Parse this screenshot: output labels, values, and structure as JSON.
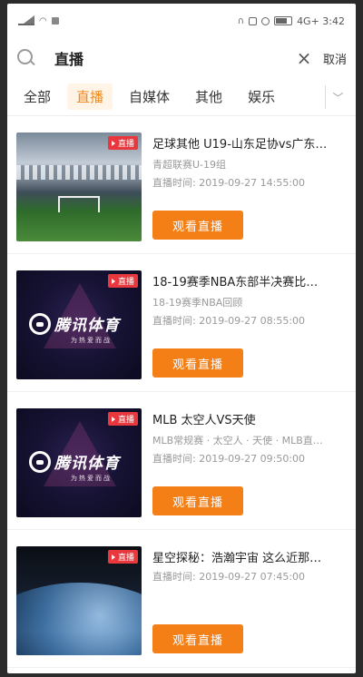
{
  "status_bar": {
    "right_text": "4G+ 3:42"
  },
  "search": {
    "query": "直播",
    "cancel_label": "取消"
  },
  "tabs": [
    {
      "label": "全部",
      "active": false
    },
    {
      "label": "直播",
      "active": true
    },
    {
      "label": "自媒体",
      "active": false
    },
    {
      "label": "其他",
      "active": false
    },
    {
      "label": "娱乐",
      "active": false
    }
  ],
  "items": [
    {
      "thumb": "stadium",
      "badge": "直播",
      "title": "足球其他 U19-山东足协vs广东…",
      "sub": "青超联赛U-19组",
      "time": "直播时间: 2019-09-27 14:55:00",
      "button": "观看直播"
    },
    {
      "thumb": "tencent",
      "badge": "直播",
      "logo_text": "腾讯体育",
      "logo_sub": "为热爱而战",
      "title": "18-19赛季NBA东部半决赛比…",
      "sub": "18-19赛季NBA回顾",
      "time": "直播时间: 2019-09-27 08:55:00",
      "button": "观看直播"
    },
    {
      "thumb": "tencent",
      "badge": "直播",
      "logo_text": "腾讯体育",
      "logo_sub": "为热爱而战",
      "title": "MLB 太空人VS天使",
      "sub": "MLB常规赛 · 太空人 · 天使 · MLB直…",
      "time": "直播时间: 2019-09-27 09:50:00",
      "button": "观看直播"
    },
    {
      "thumb": "space",
      "badge": "直播",
      "title": "星空探秘：浩瀚宇宙 这么近那…",
      "sub": "",
      "time": "直播时间: 2019-09-27 07:45:00",
      "button": "观看直播"
    }
  ]
}
